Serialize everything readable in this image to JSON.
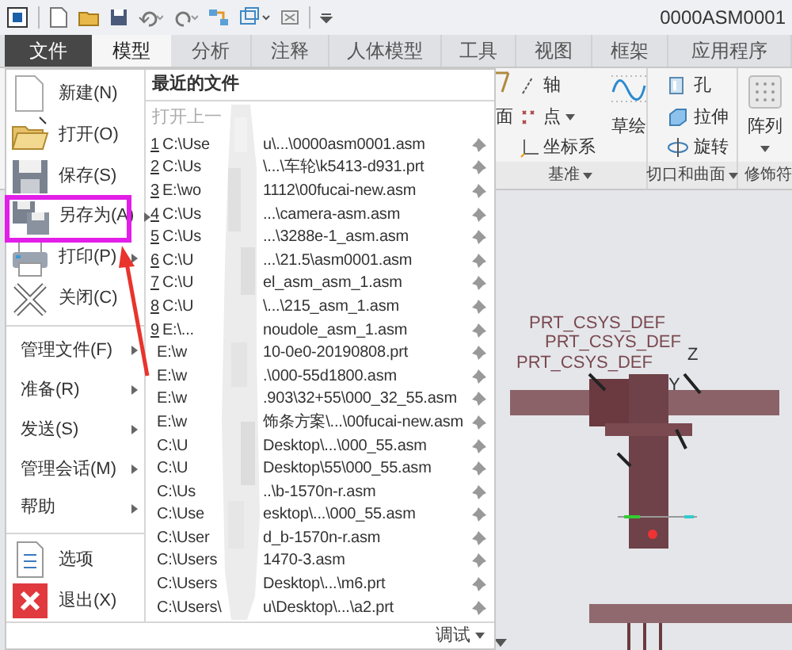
{
  "title_bar": {
    "title": "0000ASM0001"
  },
  "tabs": [
    {
      "label": "文件",
      "kind": "file",
      "selected": true
    },
    {
      "label": "模型",
      "kind": "tab",
      "selected": true
    },
    {
      "label": "分析",
      "kind": "tab",
      "selected": false
    },
    {
      "label": "注释",
      "kind": "tab",
      "selected": false
    },
    {
      "label": "人体模型",
      "kind": "tab",
      "selected": false
    },
    {
      "label": "工具",
      "kind": "tab",
      "selected": false
    },
    {
      "label": "视图",
      "kind": "tab",
      "selected": false
    },
    {
      "label": "框架",
      "kind": "tab",
      "selected": false
    },
    {
      "label": "应用程序",
      "kind": "tab",
      "selected": false
    }
  ],
  "ribbon": {
    "plane_label": "面",
    "datum_items": [
      {
        "label": "轴",
        "kind": "axis"
      },
      {
        "label": "点",
        "kind": "point"
      },
      {
        "label": "坐标系",
        "kind": "csys"
      }
    ],
    "sketch": "草绘",
    "cut_items": [
      {
        "label": "孔",
        "kind": "hole"
      },
      {
        "label": "拉伸",
        "kind": "extrude"
      },
      {
        "label": "旋转",
        "kind": "revolve"
      }
    ],
    "pattern": "阵列",
    "groups": [
      "基准",
      "切口和曲面",
      "修饰符"
    ]
  },
  "file_menu": {
    "items": [
      {
        "label": "新建(N)",
        "kind": "new",
        "submenu": false
      },
      {
        "label": "打开(O)",
        "kind": "open",
        "submenu": false
      },
      {
        "label": "保存(S)",
        "kind": "save",
        "submenu": false
      },
      {
        "label": "另存为(A)",
        "kind": "saveas",
        "submenu": true
      },
      {
        "label": "打印(P)",
        "kind": "print",
        "submenu": true
      },
      {
        "label": "关闭(C)",
        "kind": "close",
        "submenu": false
      },
      {
        "label": "管理文件(F)",
        "kind": "text",
        "submenu": true
      },
      {
        "label": "准备(R)",
        "kind": "text",
        "submenu": true
      },
      {
        "label": "发送(S)",
        "kind": "text",
        "submenu": true
      },
      {
        "label": "管理会话(M)",
        "kind": "text",
        "submenu": true
      },
      {
        "label": "帮助",
        "kind": "text",
        "submenu": true
      },
      {
        "label": "选项",
        "kind": "options",
        "submenu": false
      },
      {
        "label": "退出(X)",
        "kind": "exit",
        "submenu": false
      }
    ],
    "recent": {
      "heading": "最近的文件",
      "open_last": "打开上一",
      "files": [
        {
          "number": "1",
          "start": "C:\\Use",
          "end": "u\\...\\0000asm0001.asm"
        },
        {
          "number": "2",
          "start": "C:\\Us",
          "end": "\\...\\车轮\\k5413-d931.prt"
        },
        {
          "number": "3",
          "start": "E:\\wo",
          "end": "1112\\00fucai-new.asm"
        },
        {
          "number": "4",
          "start": "C:\\Us",
          "end": "...\\camera-asm.asm"
        },
        {
          "number": "5",
          "start": "C:\\Us",
          "end": "...\\3288e-1_asm.asm"
        },
        {
          "number": "6",
          "start": "C:\\U",
          "end": "...\\21.5\\asm0001.asm"
        },
        {
          "number": "7",
          "start": "C:\\U",
          "end": "el_asm_asm_1.asm"
        },
        {
          "number": "8",
          "start": "C:\\U",
          "end": "\\...\\215_asm_1.asm"
        },
        {
          "number": "9",
          "start": "E:\\...",
          "end": "noudole_asm_1.asm"
        },
        {
          "start": "E:\\w",
          "end": "10-0e0-20190808.prt"
        },
        {
          "start": "E:\\w",
          "end": ".\\000-55d1800.asm"
        },
        {
          "start": "E:\\w",
          "end": ".903\\32+55\\000_32_55.asm"
        },
        {
          "start": "E:\\w",
          "end": "饰条方案\\...\\00fucai-new.asm"
        },
        {
          "start": "C:\\U",
          "end": "Desktop\\...\\000_55.asm"
        },
        {
          "start": "C:\\U",
          "end": "Desktop\\55\\000_55.asm"
        },
        {
          "start": "C:\\Us",
          "end": "..\\b-1570n-r.asm"
        },
        {
          "start": "C:\\Use",
          "end": "esktop\\...\\000_55.asm"
        },
        {
          "start": "C:\\User",
          "end": "d_b-1570n-r.asm"
        },
        {
          "start": "C:\\Users",
          "end": "1470-3.asm"
        },
        {
          "start": "C:\\Users",
          "end": "Desktop\\...\\m6.prt"
        },
        {
          "start": "C:\\Users\\",
          "end": "u\\Desktop\\...\\a2.prt"
        }
      ]
    },
    "footer": "调试"
  },
  "viewport": {
    "labels": [
      {
        "text": "PRT_CSYS_DEF"
      },
      {
        "text": "PRT_CSYS_DEF"
      },
      {
        "text": "PRT_CSYS_DEF"
      },
      {
        "text": "Z"
      },
      {
        "text": "Y"
      }
    ]
  }
}
